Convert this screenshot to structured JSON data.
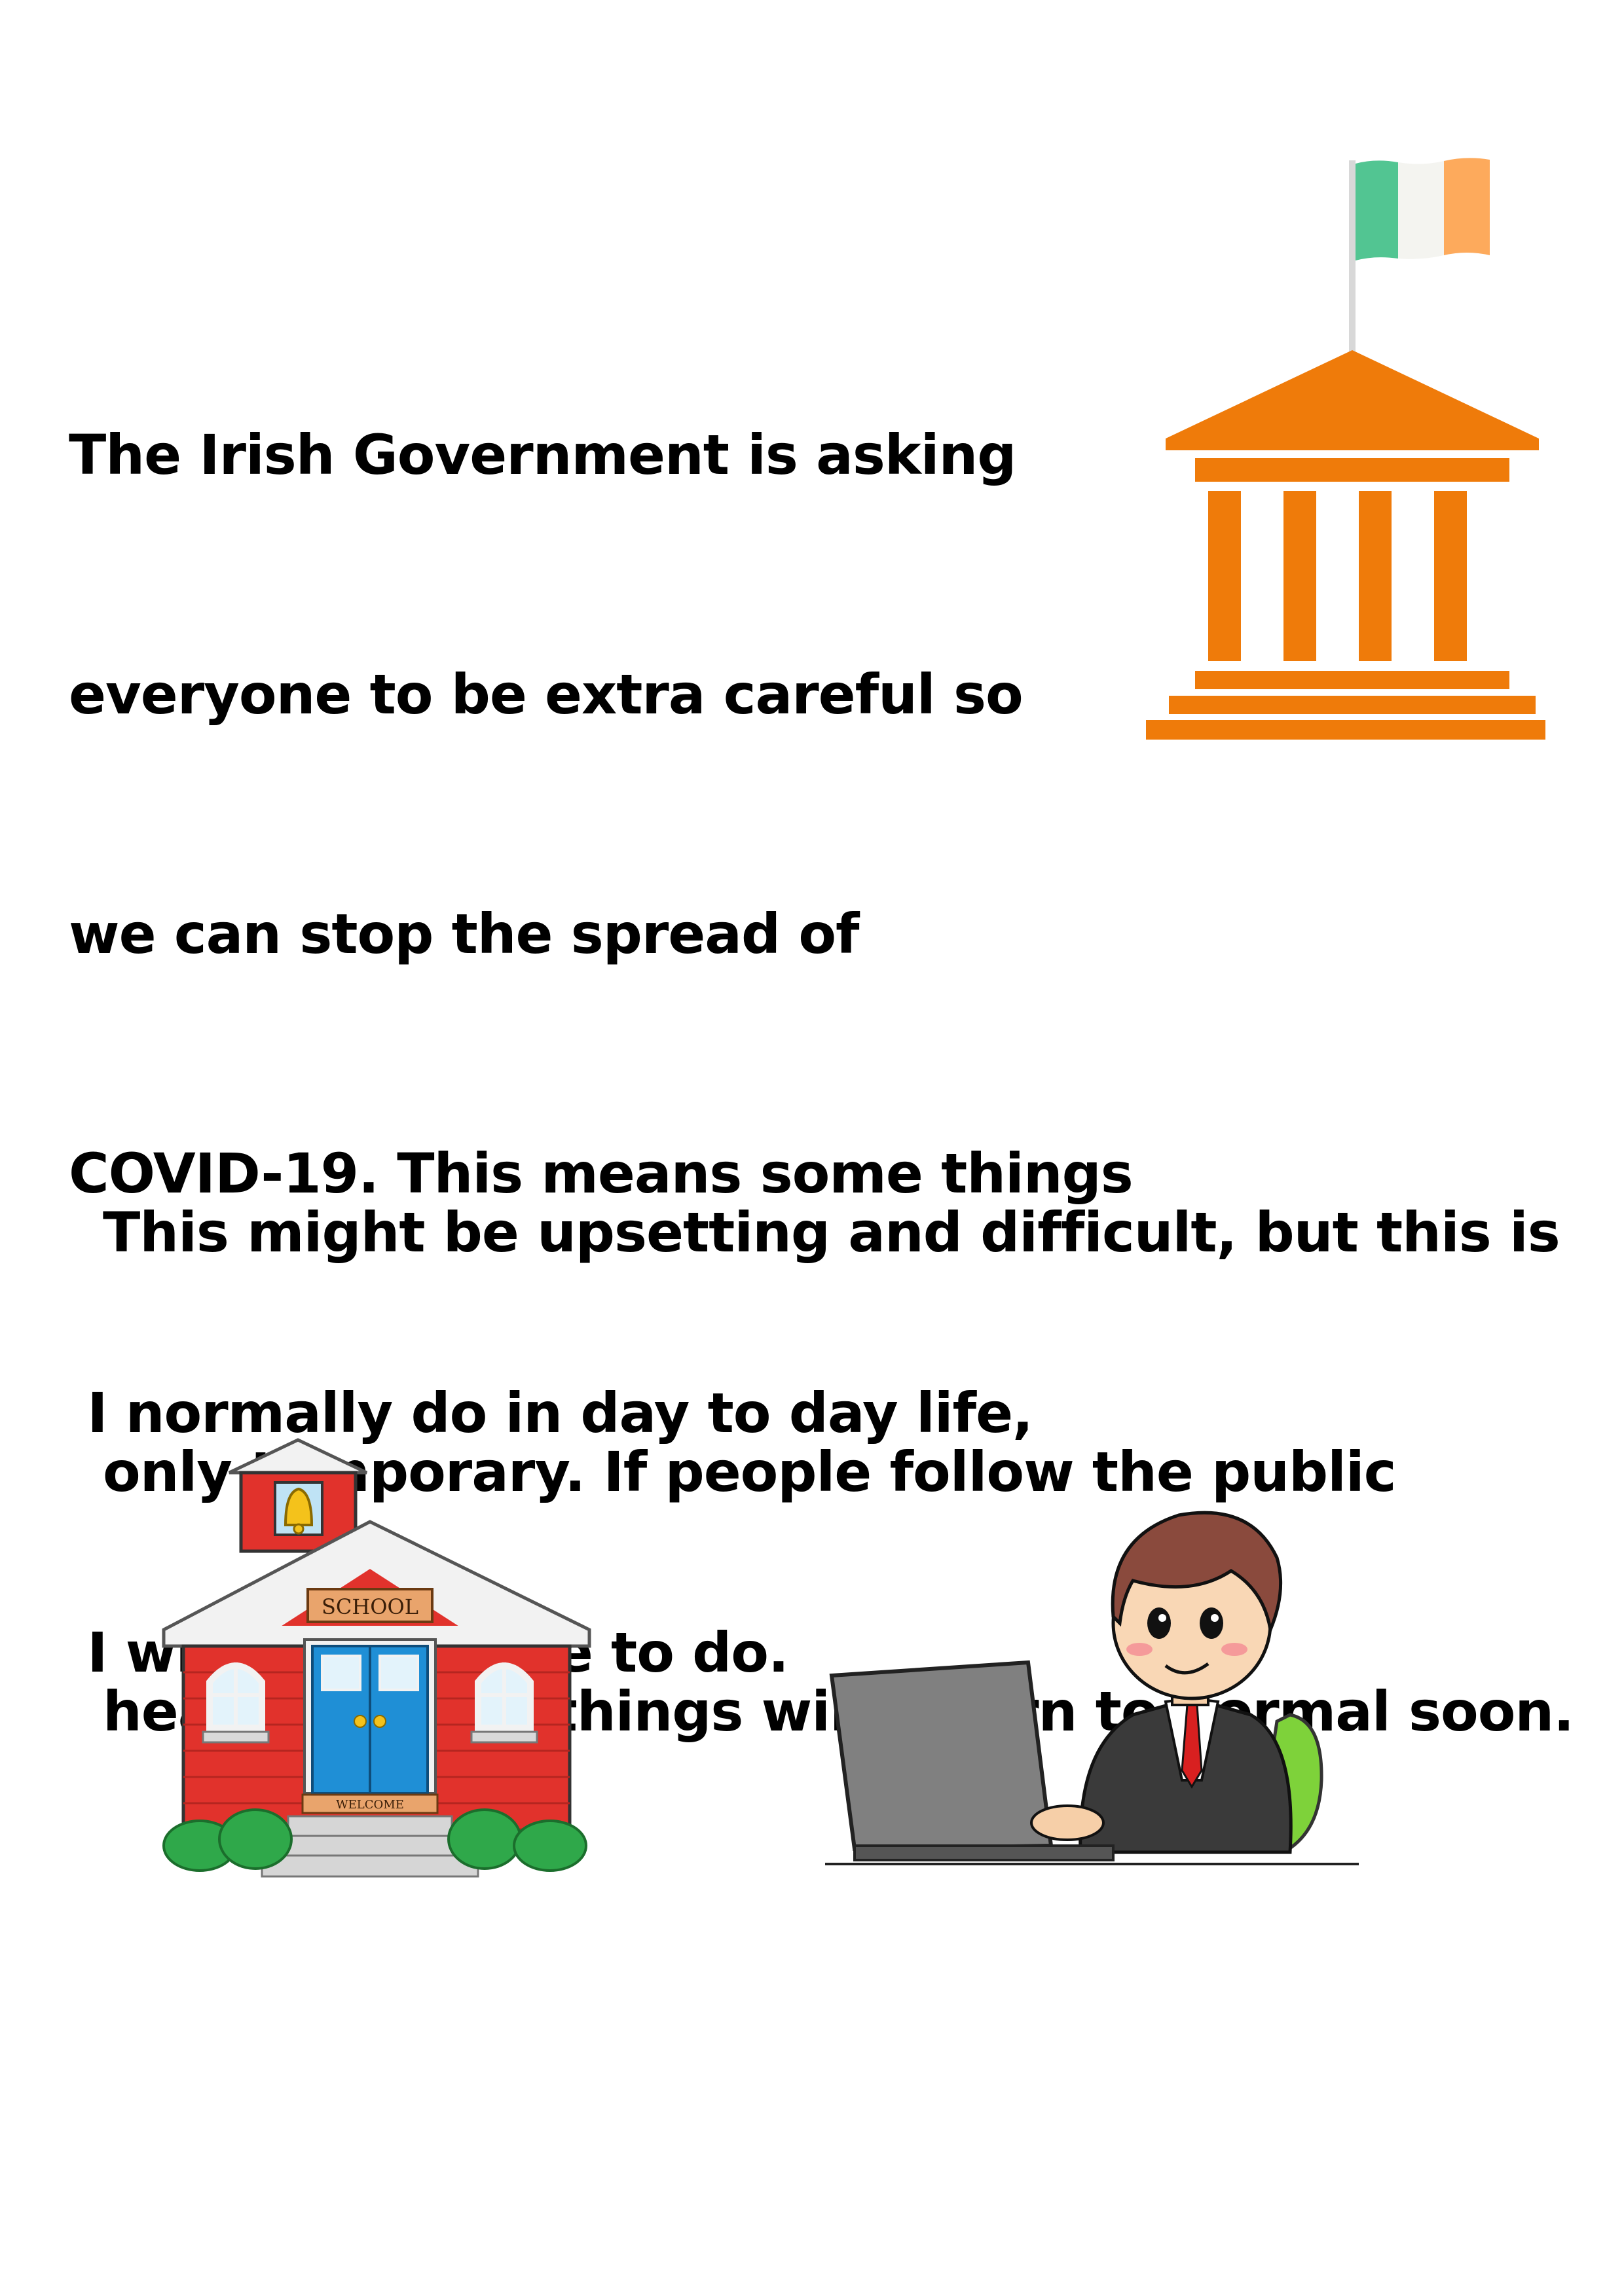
{
  "intro": {
    "lines": [
      "The Irish Government is asking",
      "everyone to be extra careful so",
      "we can stop the spread of",
      "COVID-19. This means some things",
      " I normally do in day to day life,",
      " I will not be able to do."
    ]
  },
  "reassurance": {
    "lines": [
      "This might be upsetting and difficult, but this is",
      "only temporary. If people follow the public",
      "health advice, things will return to normal soon."
    ]
  },
  "school": {
    "sign_label": "SCHOOL",
    "mat_label": "WELCOME"
  },
  "colors": {
    "building_orange": "#ef7b0a",
    "flag_green": "#52c592",
    "flag_white": "#f4f4f0",
    "flag_orange": "#fdaa5c",
    "school_red": "#e1322c",
    "door_blue": "#1f8fd6"
  },
  "icons": {
    "government": "government-building-with-irish-flag",
    "school": "school-house",
    "worker": "person-working-on-laptop"
  }
}
